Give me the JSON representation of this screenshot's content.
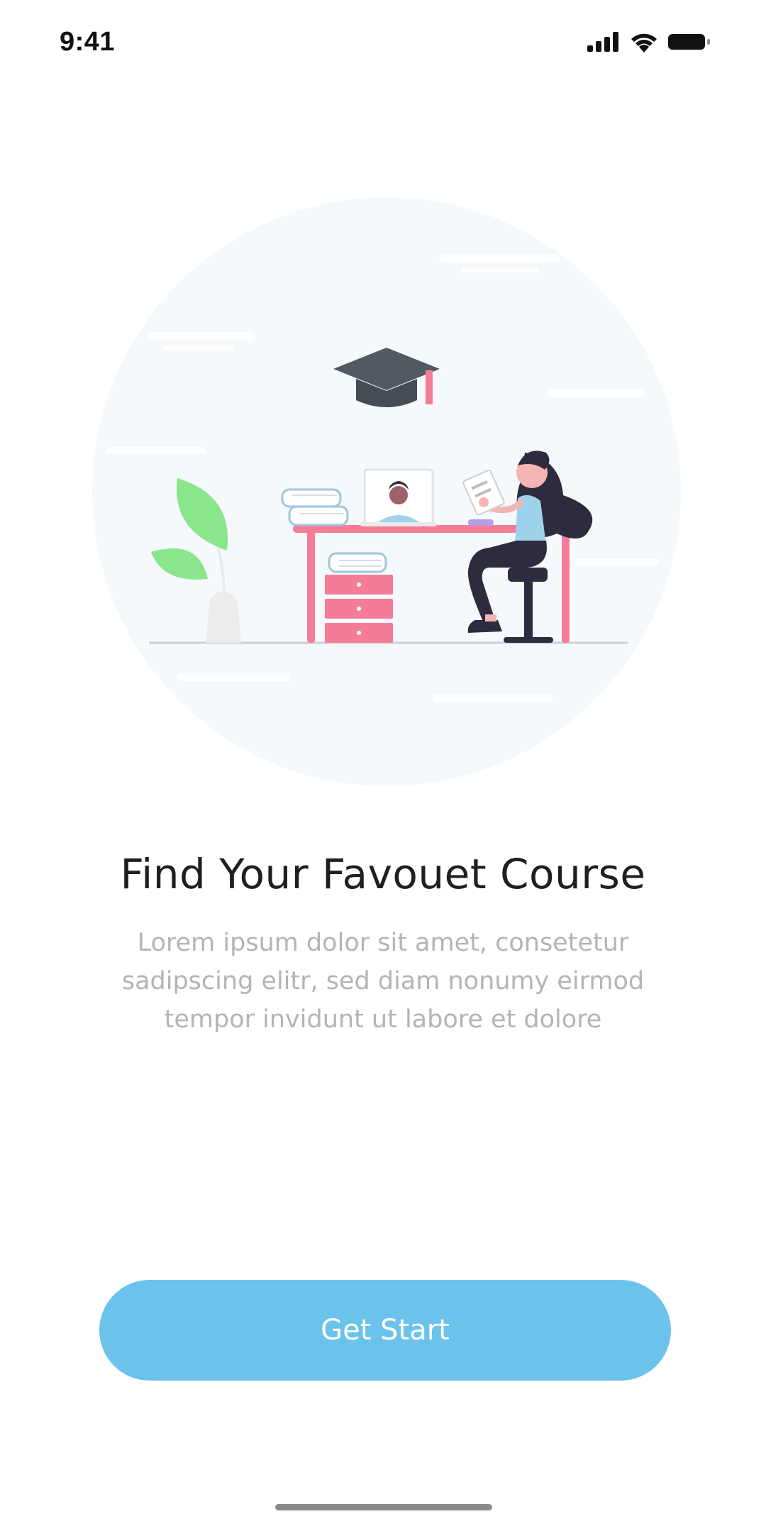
{
  "status_bar": {
    "time": "9:41",
    "icons": [
      "signal-icon",
      "wifi-icon",
      "battery-icon"
    ]
  },
  "illustration": {
    "name": "online-course-illustration",
    "colors": {
      "background_circle": "#f5f9fc",
      "desk": "#f47c96",
      "plant": "#8ae68a",
      "cap": "#525a61",
      "hair": "#2e2b3e",
      "shirt": "#9fd2ea"
    }
  },
  "onboarding": {
    "title": "Find Your Favouet Course",
    "description": "Lorem ipsum dolor sit amet, consetetur sadipscing elitr, sed diam nonumy eirmod tempor invidunt ut labore et dolore"
  },
  "cta": {
    "label": "Get Start",
    "color": "#6bc3ec"
  }
}
